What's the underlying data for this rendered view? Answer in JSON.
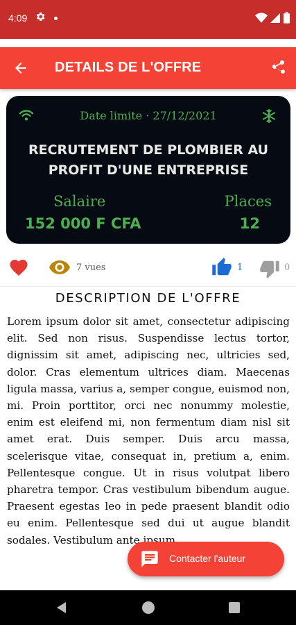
{
  "status_bar": {
    "time": "4:09",
    "icons": [
      "settings-icon",
      "notification-dot",
      "wifi-icon",
      "signal-icon",
      "battery-icon"
    ]
  },
  "app_bar": {
    "title": "DETAILS DE L'OFFRE",
    "back_icon": "arrow-back-icon",
    "share_icon": "share-icon",
    "color": "#f44336"
  },
  "offer": {
    "deadline": "Date limite · 27/12/2021",
    "title": "RECRUTEMENT DE PLOMBIER AU PROFIT D'UNE ENTREPRISE",
    "salary_label": "Salaire",
    "salary_value": "152 000 F CFA",
    "places_label": "Places",
    "places_value": "12",
    "accent": "#4caf50",
    "background": "#060a12"
  },
  "stats": {
    "views": "7 vues",
    "likes": "1",
    "dislikes": "0",
    "like_color": "#1e6bd6",
    "favorite_color": "#e53935"
  },
  "description": {
    "heading": "DESCRIPTION DE L'OFFRE",
    "body": "Lorem ipsum dolor sit amet, consectetur adipiscing elit. Sed non risus. Suspendisse lectus tortor, dignissim sit amet, adipiscing nec, ultricies sed, dolor. Cras elementum ultrices diam. Maecenas ligula massa, varius a, semper congue, euismod non, mi. Proin porttitor, orci nec nonummy molestie, enim est eleifend mi, non fermentum diam nisl sit amet erat. Duis semper. Duis arcu massa, scelerisque vitae, consequat in, pretium a, enim. Pellentesque congue. Ut in risus volutpat libero pharetra tempor. Cras vestibulum bibendum augue. Praesent egestas leo in pede praesent blandit odio eu enim. Pellentesque sed dui ut augue blandit sodales. Vestibulum ante ipsum"
  },
  "fab": {
    "label": "Contacter l'auteur",
    "icon": "message-icon"
  },
  "nav_bar": {
    "icons": [
      "nav-back-icon",
      "nav-home-icon",
      "nav-recents-icon"
    ]
  }
}
